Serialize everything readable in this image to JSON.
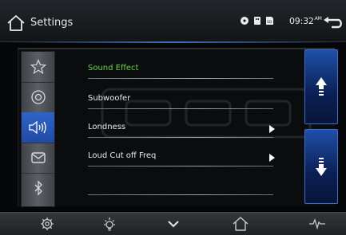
{
  "header": {
    "title": "Settings",
    "time": "09:32",
    "ampm": "AM"
  },
  "tabs": [
    {
      "icon": "star-icon",
      "active": false
    },
    {
      "icon": "disc-icon",
      "active": false
    },
    {
      "icon": "speaker-icon",
      "active": true
    },
    {
      "icon": "mail-icon",
      "active": false
    },
    {
      "icon": "bluetooth-icon",
      "active": false
    }
  ],
  "list": {
    "items": [
      {
        "label": "Sound Effect",
        "highlighted": true,
        "has_arrow": false
      },
      {
        "label": "Subwoofer",
        "highlighted": false,
        "has_arrow": false
      },
      {
        "label": "Londness",
        "highlighted": false,
        "has_arrow": true
      },
      {
        "label": "Loud Cut off Freq",
        "highlighted": false,
        "has_arrow": true
      }
    ]
  },
  "dock": {
    "items": [
      "gear-icon",
      "brightness-icon",
      "chevron-down-icon",
      "home-icon",
      "waveform-icon"
    ]
  },
  "colors": {
    "accent": "#2f63c8",
    "highlight_text": "#63d33e"
  }
}
